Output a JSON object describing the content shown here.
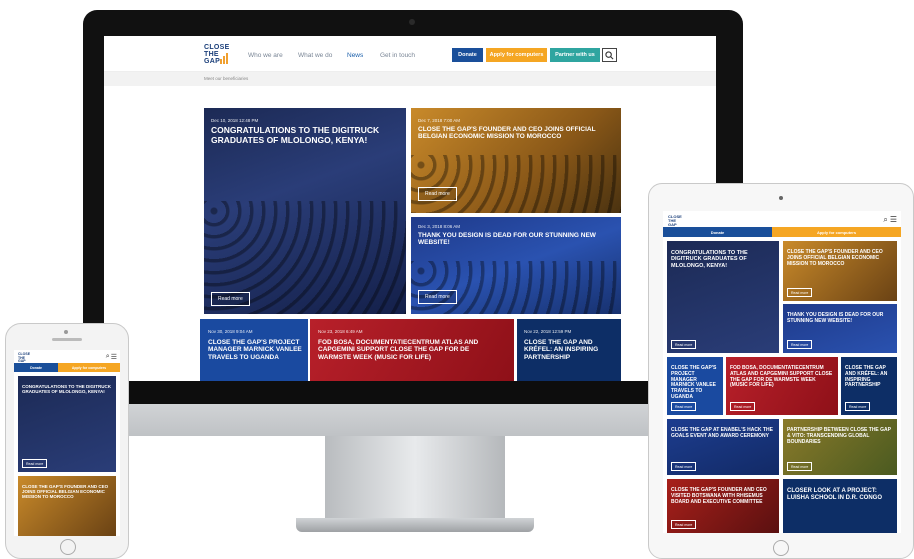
{
  "site": {
    "logo_lines": [
      "CLOSE",
      "THE",
      "GAP"
    ],
    "nav": [
      "Who we are",
      "What we do",
      "News",
      "Get in touch"
    ],
    "active_nav": "News",
    "buttons": {
      "donate": "Donate",
      "apply": "Apply for computers",
      "partner": "Partner with us"
    },
    "breadcrumb": "Meet our beneficiaries",
    "read_more": "Read more"
  },
  "desktop_cards": [
    {
      "ts": "Dec 10, 2018 12:48 PM",
      "title": "Congratulations to the Digitruck graduates of Mlolongo, Kenya!",
      "color": "#1c2a55"
    },
    {
      "ts": "Dec 7, 2018 7:00 AM",
      "title": "Close the Gap's founder and CEO joins official Belgian economic mission to Morocco",
      "color": "#c98a2a"
    },
    {
      "ts": "Dec 3, 2018 8:06 AM",
      "title": "Thank you Design is Dead for our stunning new website!",
      "color": "#1f3a8a"
    },
    {
      "ts": "Nov 30, 2018 9:04 AM",
      "title": "Close the Gap's project manager Marnick Vanlee travels to Uganda",
      "color": "#1a4aa0"
    },
    {
      "ts": "Nov 23, 2018 6:49 AM",
      "title": "FOD BOSA, Documentatiecentrum Atlas and Capgemini support Close the Gap for De Warmste Week (Music for Life)",
      "color": "#b8202a"
    },
    {
      "ts": "Nov 22, 2018 12:59 PM",
      "title": "Close the Gap and Kréfel: an inspiring partnership",
      "color": "#0d2e66"
    }
  ],
  "tablet_cards": [
    {
      "title": "Congratulations to the Digitruck graduates of Mlolongo, Kenya!"
    },
    {
      "title": "Close the Gap's founder and CEO joins official Belgian economic mission to Morocco"
    },
    {
      "title": "Thank you Design is Dead for our stunning new website!"
    },
    {
      "title": "Close the Gap's project manager Marnick Vanlee travels to Uganda"
    },
    {
      "title": "FOD BOSA, Documentatiecentrum Atlas and Capgemini support Close the Gap for De Warmste Week (Music for Life)"
    },
    {
      "title": "Close the Gap and Kréfel: an inspiring partnership"
    },
    {
      "title": "Close the Gap at Enabel's hack the goals event and award ceremony"
    },
    {
      "title": "Partnership between Close the Gap & Vito: transcending global boundaries"
    },
    {
      "title": "Close the Gap's founder and CEO visited Botswana with Rhisemus board and executive committee"
    },
    {
      "title": "Closer look at a project: Luisha school in D.R. Congo"
    }
  ],
  "phone_cards": [
    {
      "title": "Congratulations to the Digitruck graduates of Mlolongo, Kenya!"
    },
    {
      "title": "Close the Gap's founder and CEO joins official Belgian economic mission to Morocco"
    }
  ]
}
